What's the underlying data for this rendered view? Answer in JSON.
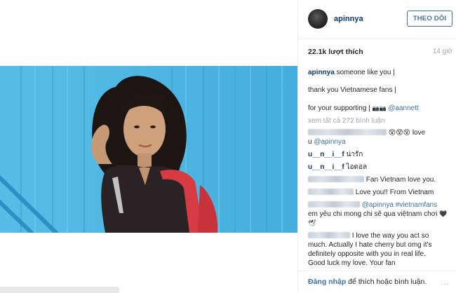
{
  "post": {
    "username": "apinnya",
    "follow_label": "THEO DÕI",
    "likes": "22.1k lượt thích",
    "time": "14 giờ"
  },
  "caption": {
    "username": "apinnya",
    "line1": "someone like you |",
    "line2": "thank you Vietnamese fans |",
    "line3_text": "for your supporting |",
    "line3_emoji": "📷📷",
    "line3_mention": "@aannett"
  },
  "view_all": "xem tất cả 272 bình luận",
  "comments": [
    {
      "id": "c1",
      "username_blurred": true,
      "text_a": "😵😵😵 love",
      "text_b": "u",
      "mention": "@apinnya"
    },
    {
      "id": "c2",
      "username": "u__n__i__f",
      "text": "น่ารัก"
    },
    {
      "id": "c3",
      "username": "u__n__i__f",
      "text": "ไอดอล"
    },
    {
      "id": "c4",
      "username_blurred": true,
      "text": "Fan Vietnam love you."
    },
    {
      "id": "c5",
      "username_blurred": true,
      "text": "Love you!! From Vietnam"
    },
    {
      "id": "c6",
      "username_blurred": true,
      "mention": "@apinnya",
      "hashtag": "#vietnamfans",
      "text": "em yêu chi mong chi sẽ qua việtnam chơi",
      "emoji": "🖤🕊"
    },
    {
      "id": "c7",
      "username_blurred": true,
      "text_a": "I love the way you act so",
      "text_b": "much. Actually I hate cherry but omg it's",
      "text_c": "definitely opposite with you in real life.",
      "text_d": "Good luck my love. Your fan"
    }
  ],
  "footer": {
    "login_link": "Đăng nhập",
    "login_rest": "để thích hoặc bình luận.",
    "more": "..."
  },
  "icons": [
    "avatar",
    "more-options-icon"
  ],
  "colors": {
    "link": "#3f729b",
    "username": "#12376e",
    "muted": "#a5a7aa",
    "photo_bg": "#4fb6e3"
  }
}
